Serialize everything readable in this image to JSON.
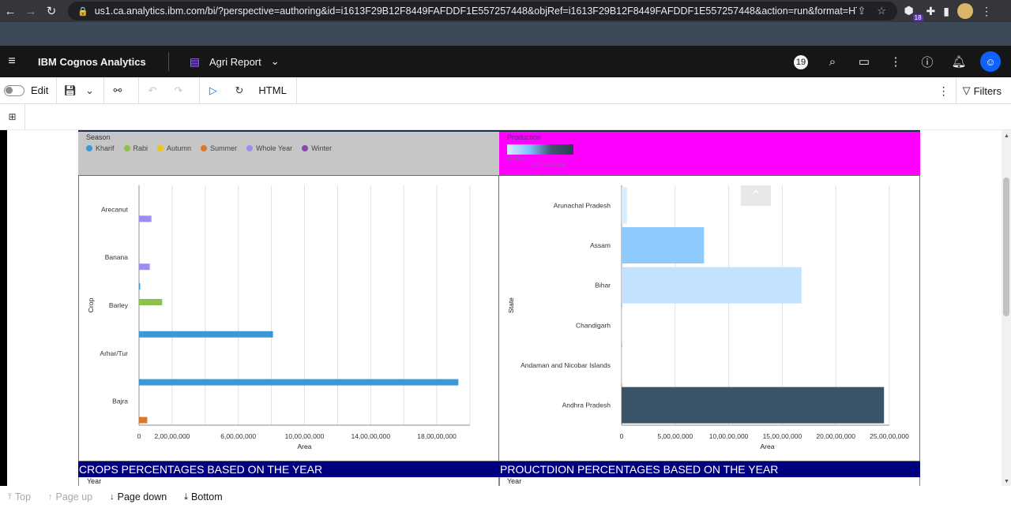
{
  "browser": {
    "url": "us1.ca.analytics.ibm.com/bi/?perspective=authoring&id=i1613F29B12F8449FAFDDF1E557257448&objRef=i1613F29B12F8449FAFDDF1E557257448&action=run&format=HTML&cmProp...",
    "extension_badge": "18"
  },
  "app": {
    "title": "IBM Cognos Analytics",
    "report_name": "Agri Report",
    "notification_count": "19"
  },
  "toolbar": {
    "edit_label": "Edit",
    "format_label": "HTML",
    "filters_label": "Filters"
  },
  "legend_left": {
    "title": "Season",
    "items": [
      {
        "label": "Kharif",
        "color": "#3a9ad9"
      },
      {
        "label": "Rabi",
        "color": "#8bc34a"
      },
      {
        "label": "Autumn",
        "color": "#f1c40f"
      },
      {
        "label": "Summer",
        "color": "#d9772a"
      },
      {
        "label": "Whole Year",
        "color": "#9f8cf0"
      },
      {
        "label": "Winter",
        "color": "#8e44ad"
      }
    ]
  },
  "legend_right": {
    "title": "Production",
    "min_label": "69,591.3",
    "max_label": "16,07,62,28,605"
  },
  "sections": {
    "left_title": "CROPS PERCENTAGES BASED ON THE YEAR",
    "right_title": "PROUCTDION PERCENTAGES BASED ON THE YEAR",
    "left_year": "Year",
    "right_year": "Year"
  },
  "paging": {
    "top": "Top",
    "page_up": "Page up",
    "page_down": "Page down",
    "bottom": "Bottom"
  },
  "chart_data": [
    {
      "type": "bar",
      "orientation": "horizontal",
      "ylabel": "Crop",
      "xlabel": "Area",
      "xlim": [
        0,
        20000000
      ],
      "x_ticks": [
        "0",
        "2,00,00,000",
        "6,00,00,000",
        "10,00,00,000",
        "14,00,00,000",
        "18,00,00,000"
      ],
      "categories": [
        "Arecanut",
        "Banana",
        "Barley",
        "Arhar/Tur",
        "Bajra"
      ],
      "series": [
        {
          "name": "Kharif",
          "values": [
            0,
            0,
            50000,
            8100000,
            19300000
          ]
        },
        {
          "name": "Rabi",
          "values": [
            0,
            0,
            1400000,
            0,
            0
          ]
        },
        {
          "name": "Autumn",
          "values": [
            0,
            0,
            0,
            0,
            0
          ]
        },
        {
          "name": "Summer",
          "values": [
            0,
            0,
            0,
            0,
            500000
          ]
        },
        {
          "name": "Whole Year",
          "values": [
            750000,
            650000,
            0,
            0,
            0
          ]
        },
        {
          "name": "Winter",
          "values": [
            0,
            0,
            0,
            0,
            0
          ]
        }
      ]
    },
    {
      "type": "bar",
      "orientation": "horizontal",
      "ylabel": "State",
      "xlabel": "Area",
      "xlim": [
        0,
        25000000
      ],
      "x_ticks": [
        "0",
        "5,00,00,000",
        "10,00,00,000",
        "15,00,00,000",
        "20,00,00,000",
        "25,00,00,000"
      ],
      "categories": [
        "Arunachal Pradesh",
        "Assam",
        "Bihar",
        "Chandigarh",
        "Andaman and Nicobar Islands",
        "Andhra Pradesh"
      ],
      "values": [
        500000,
        7700000,
        16800000,
        10000,
        50000,
        24500000
      ],
      "colors": [
        "#d6ecff",
        "#8dcbff",
        "#c2e2ff",
        "#d6ecff",
        "#d6ecff",
        "#3b5366"
      ]
    }
  ]
}
